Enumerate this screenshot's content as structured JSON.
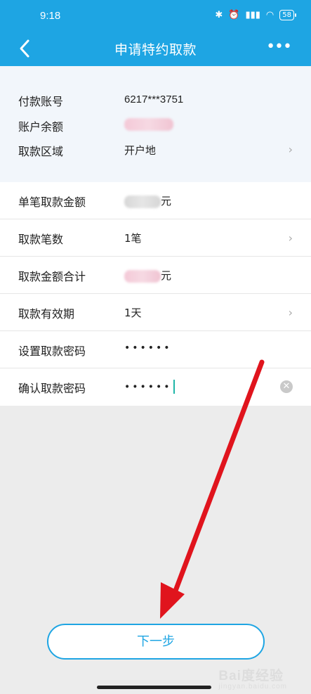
{
  "status_bar": {
    "time": "9:18",
    "battery": "58"
  },
  "header": {
    "title": "申请特约取款",
    "more": "•••"
  },
  "info": {
    "account_label": "付款账号",
    "account_value": "6217***3751",
    "balance_label": "账户余额",
    "region_label": "取款区域",
    "region_value": "开户地"
  },
  "form": {
    "single_amount_label": "单笔取款金额",
    "single_amount_unit": "元",
    "count_label": "取款笔数",
    "count_value": "1笔",
    "total_label": "取款金额合计",
    "total_unit": "元",
    "validity_label": "取款有效期",
    "validity_value": "1天",
    "set_password_label": "设置取款密码",
    "set_password_value": "••••••",
    "confirm_password_label": "确认取款密码",
    "confirm_password_value": "••••••"
  },
  "next_button": "下一步",
  "watermark": {
    "brand": "Bai度经验",
    "url": "jingyan.baidu.com"
  },
  "colors": {
    "primary": "#1ea5e3",
    "arrow": "#e0141d"
  }
}
